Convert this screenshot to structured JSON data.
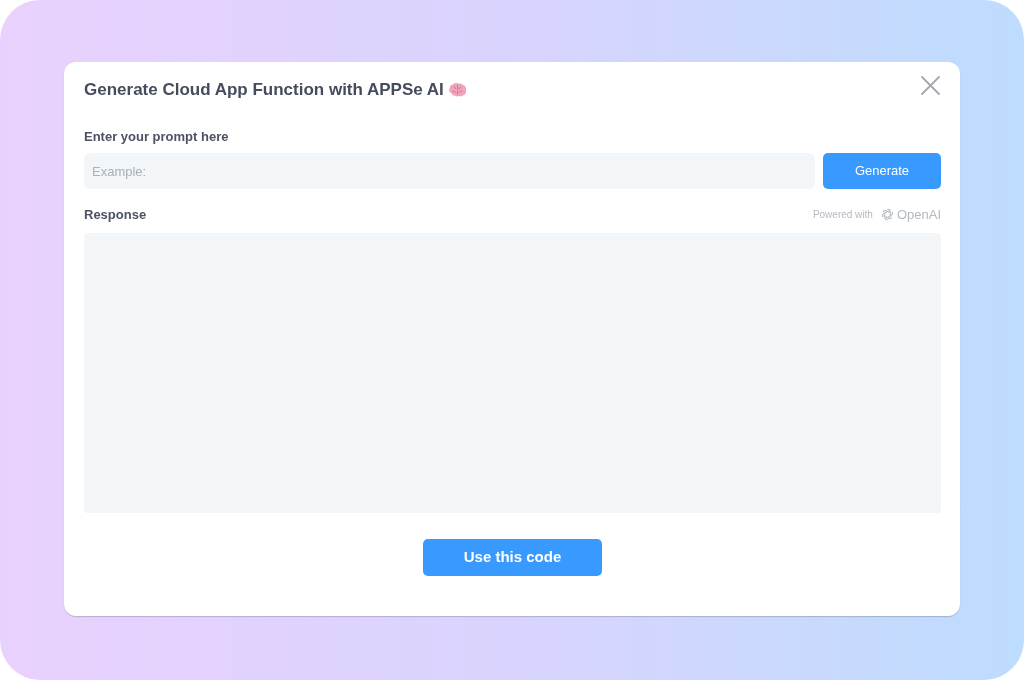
{
  "dialog": {
    "title": "Generate Cloud App Function with APPSe AI",
    "prompt": {
      "label": "Enter your prompt here",
      "placeholder": "Example:"
    },
    "generate_button": "Generate",
    "response": {
      "label": "Response",
      "powered_with": "Powered with",
      "provider": "OpenAI"
    },
    "primary_button": "Use this code"
  }
}
